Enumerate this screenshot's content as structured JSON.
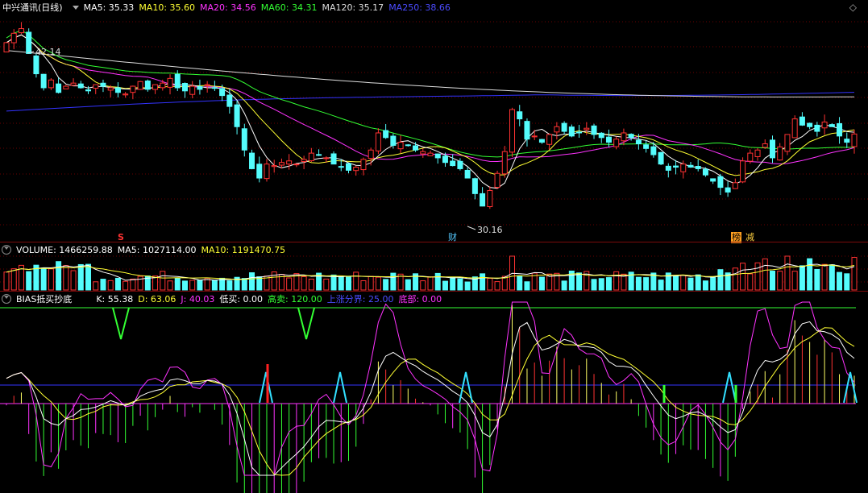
{
  "main_header": {
    "title": "中兴通讯(日线)",
    "ma": [
      {
        "label": "MA5: 35.33",
        "color": "#ffffff"
      },
      {
        "label": "MA10: 35.60",
        "color": "#ffff33"
      },
      {
        "label": "MA20: 34.56",
        "color": "#ff33ff"
      },
      {
        "label": "MA60: 34.31",
        "color": "#33ff33"
      },
      {
        "label": "MA120: 35.17",
        "color": "#dddddd"
      },
      {
        "label": "MA250: 38.66",
        "color": "#3333ff"
      }
    ]
  },
  "price_labels": {
    "high": "42.14",
    "low": "30.16"
  },
  "markers": {
    "s": "S",
    "cai": "财",
    "bang": "榜",
    "jian": "减"
  },
  "volume_header": {
    "volume": "VOLUME: 1466259.88",
    "ma5": "MA5: 1027114.00",
    "ma10": "MA10: 1191470.75"
  },
  "bias_header": {
    "title": "BIAS抵买抄底",
    "items": [
      {
        "label": "K: 55.38",
        "color": "#ffffff"
      },
      {
        "label": "D: 63.06",
        "color": "#ffff33"
      },
      {
        "label": "J: 40.03",
        "color": "#ff33ff"
      },
      {
        "label": "低买: 0.00",
        "color": "#ffffff"
      },
      {
        "label": "高卖: 120.00",
        "color": "#33ff33"
      },
      {
        "label": "上涨分界: 25.00",
        "color": "#3333ff"
      },
      {
        "label": "底部: 0.00",
        "color": "#ff33ff"
      }
    ]
  },
  "colors": {
    "up": "#ff3232",
    "down": "#54fcfc",
    "ma5": "#ffffff",
    "ma10": "#ffff33",
    "ma20": "#ff33ff",
    "ma60": "#33ff33",
    "ma120": "#dddddd",
    "ma250": "#3333ff"
  },
  "chart_data": {
    "type": "candlestick",
    "closes": [
      41.2,
      41.8,
      42.1,
      40.5,
      39.2,
      38.3,
      38.8,
      38.0,
      38.4,
      38.6,
      38.3,
      38.1,
      38.5,
      38.4,
      38.3,
      38.0,
      37.9,
      38.4,
      38.7,
      38.2,
      38.5,
      38.6,
      38.9,
      38.3,
      38.1,
      38.4,
      38.2,
      38.5,
      38.3,
      37.8,
      37.1,
      35.8,
      34.3,
      33.1,
      32.5,
      33.4,
      33.3,
      33.5,
      33.6,
      33.4,
      33.7,
      34.1,
      34.0,
      33.8,
      33.4,
      33.2,
      33.0,
      33.2,
      33.7,
      34.3,
      35.4,
      35.1,
      34.6,
      34.8,
      34.6,
      34.3,
      34.2,
      34.1,
      33.8,
      33.5,
      33.3,
      33.1,
      32.5,
      31.5,
      30.7,
      31.7,
      32.8,
      34.2,
      36.9,
      36.3,
      35.0,
      35.2,
      34.8,
      35.3,
      35.8,
      35.5,
      35.2,
      35.4,
      35.7,
      35.3,
      35.1,
      34.8,
      35.0,
      35.4,
      35.1,
      34.7,
      34.4,
      34.0,
      33.4,
      33.0,
      33.2,
      33.4,
      33.2,
      33.1,
      32.7,
      32.3,
      31.9,
      31.6,
      32.2,
      33.6,
      34.1,
      34.3,
      34.7,
      33.8,
      34.5,
      35.3,
      36.3,
      35.9,
      35.8,
      35.5,
      36.1,
      35.8,
      35.2,
      34.8,
      35.33
    ],
    "volume": {
      "last": 1466259.88,
      "ma5": 1027114.0,
      "ma10": 1191470.75
    },
    "kdj": {
      "K": 55.38,
      "D": 63.06,
      "J": 40.03
    },
    "levels": {
      "low_buy": 0.0,
      "high_sell": 120.0,
      "rise_line": 25.0,
      "bottom": 0.0
    },
    "price_high": 42.14,
    "price_low": 30.16
  }
}
